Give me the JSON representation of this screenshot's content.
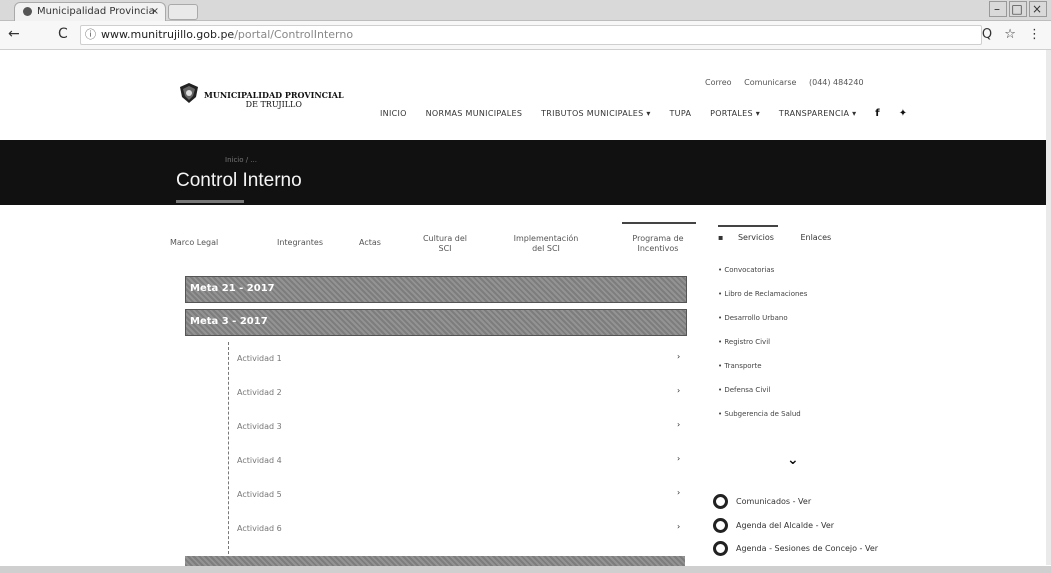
{
  "browser": {
    "tab_title": "Municipalidad Provincia",
    "tab_close": "×",
    "url_host": "www.munitrujillo.gob.pe",
    "url_path": "/portal/ControlInterno",
    "back": "←",
    "reload": "C",
    "info": "ⓘ",
    "zoom_icon": "Q",
    "star_icon": "☆",
    "menu_icon": "⋮"
  },
  "header": {
    "logo_line1": "MUNICIPALIDAD PROVINCIAL",
    "logo_line2": "DE TRUJILLO",
    "top_links": [
      "Correo",
      "Comunicarse",
      "(044) 484240"
    ],
    "nav": [
      "INICIO",
      "NORMAS MUNICIPALES",
      "TRIBUTOS MUNICIPALES ▾",
      "TUPA",
      "PORTALES ▾",
      "TRANSPARENCIA ▾"
    ],
    "social_f": "f",
    "social_t": "✦"
  },
  "banner": {
    "breadcrumb": "Inicio / ...",
    "title": "Control Interno"
  },
  "tabs": [
    "Marco Legal",
    "Integrantes",
    "Actas",
    "Cultura del SCI",
    "Implementación del SCI",
    "Programa de Incentivos"
  ],
  "accordion": {
    "meta1": "Meta 21 - 2017",
    "meta2": "Meta 3 - 2017",
    "activities": [
      "Actividad 1",
      "Actividad 2",
      "Actividad 3",
      "Actividad 4",
      "Actividad 5",
      "Actividad 6"
    ],
    "chevron": "›"
  },
  "sidebar": {
    "tabs": [
      "Servicios",
      "Enlaces"
    ],
    "links": [
      "Convocatorias",
      "Libro de Reclamaciones",
      "Desarrollo Urbano",
      "Registro Civil",
      "Transporte",
      "Defensa Civil",
      "Subgerencia de Salud"
    ],
    "expand": "⌄",
    "featured": [
      "Comunicados - Ver",
      "Agenda del Alcalde - Ver",
      "Agenda - Sesiones de Concejo - Ver"
    ]
  }
}
